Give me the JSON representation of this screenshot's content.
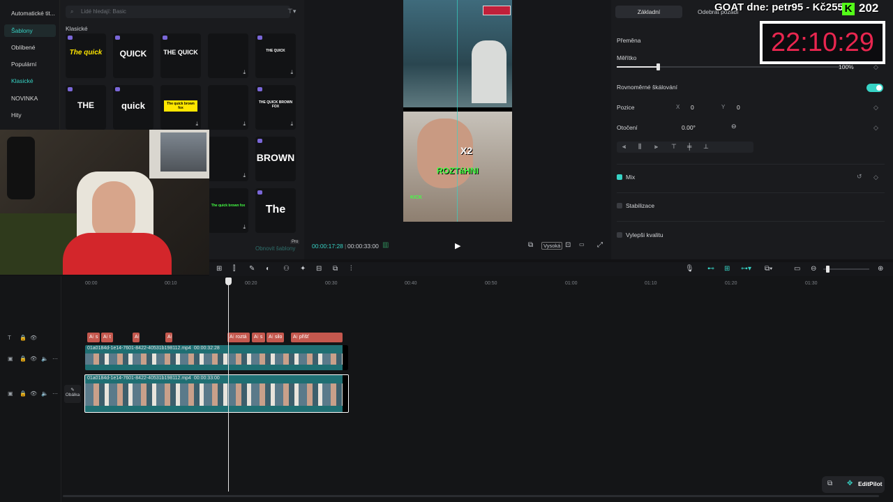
{
  "left_nav": {
    "items": [
      {
        "label": "Automatické tit...",
        "active": false
      },
      {
        "label": "Šablony",
        "active": true
      },
      {
        "label": "Oblíbené",
        "active": false
      },
      {
        "label": "Populární",
        "active": false
      },
      {
        "label": "Klasické",
        "active": false,
        "accent": true
      },
      {
        "label": "NOVINKA",
        "active": false
      },
      {
        "label": "Hity",
        "active": false
      }
    ]
  },
  "templates": {
    "search_placeholder": "Lidé hledají: Basic",
    "section": "Klasické",
    "tiles": [
      {
        "text": "The quick"
      },
      {
        "text": "QUICK"
      },
      {
        "text": "THE QUICK"
      },
      {
        "text": ""
      },
      {
        "text": "THE QUICK"
      },
      {
        "text": "THE"
      },
      {
        "text": "quick"
      },
      {
        "text": "The quick brown fox"
      },
      {
        "text": ""
      },
      {
        "text": "THE QUICK BROWN FOX"
      },
      {
        "text": ""
      },
      {
        "text": "BROWN"
      },
      {
        "text": "The quick brown fox"
      },
      {
        "text": "The"
      }
    ],
    "renew_label": "Obnovit šablony",
    "pro_label": "Pro"
  },
  "preview": {
    "caption": "ROZTáHNI",
    "badge": "X2",
    "kick_label": "KICK",
    "time_current": "00:00:17:28",
    "time_total": "00:00:33:00",
    "quality": "Vysoká"
  },
  "properties": {
    "tab_basic": "Základní",
    "tab_remove": "Odebrat pozadí",
    "transform": "Přeměna",
    "scale_label": "Měřítko",
    "scale_value": "100%",
    "scale_level": 0.18,
    "uniform_scale": "Rovnoměrné škálování",
    "uniform_scale_on": true,
    "position_label": "Pozice",
    "x_label": "X",
    "x_value": "0",
    "y_label": "Y",
    "y_value": "0",
    "rotation_label": "Otočení",
    "rotation_value": "0.00°",
    "mix_label": "Mix",
    "stabilize_label": "Stabilizace",
    "enhance_label": "Vylepši kvalitu"
  },
  "overlay": {
    "goat_text": "GOAT dne: petr95 - Kč2550",
    "kick_letter": "K",
    "count": "202",
    "clock": "22:10:29"
  },
  "timeline": {
    "ruler": [
      "00:00",
      "00:10",
      "00:20",
      "00:30",
      "00:40",
      "00:50",
      "01:00",
      "01:10",
      "01:20",
      "01:30"
    ],
    "text_clips": [
      {
        "label": "A⁝ s"
      },
      {
        "label": "A⁝ t"
      },
      {
        "label": "A⁝"
      },
      {
        "label": "A⁝"
      },
      {
        "label": "A⁝ roztá"
      },
      {
        "label": "A⁝ s"
      },
      {
        "label": "A⁝ silo"
      },
      {
        "label": "A⁝ přišť"
      }
    ],
    "clip1_name": "01a0184d-1e14-7601-8422-40531b198112.mp4",
    "clip1_duration": "00:00:32:28",
    "clip2_name": "01a0184d-1e14-7601-8422-40531b198112.mp4",
    "clip2_duration": "00:00:33:00",
    "cover_label": "Obálka"
  },
  "assistant": {
    "label": "EditPilot"
  }
}
